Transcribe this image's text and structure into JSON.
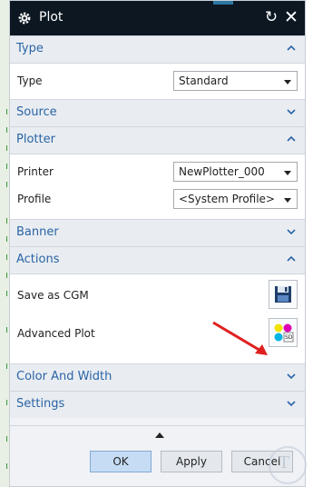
{
  "window": {
    "title": "Plot"
  },
  "sections": {
    "type": {
      "title": "Type",
      "expanded": true,
      "rows": [
        {
          "label": "Type",
          "value": "Standard"
        }
      ]
    },
    "source": {
      "title": "Source",
      "expanded": false
    },
    "plotter": {
      "title": "Plotter",
      "expanded": true,
      "rows": [
        {
          "label": "Printer",
          "value": "NewPlotter_000"
        },
        {
          "label": "Profile",
          "value": "<System Profile>"
        }
      ]
    },
    "banner": {
      "title": "Banner",
      "expanded": false
    },
    "actions": {
      "title": "Actions",
      "expanded": true,
      "rows": [
        {
          "label": "Save as CGM",
          "icon": "save-icon"
        },
        {
          "label": "Advanced Plot",
          "icon": "advanced-plot-icon"
        }
      ]
    },
    "color_width": {
      "title": "Color And Width",
      "expanded": false
    },
    "settings": {
      "title": "Settings",
      "expanded": false
    }
  },
  "footer": {
    "ok_label": "OK",
    "apply_label": "Apply",
    "cancel_label": "Cancel"
  },
  "colors": {
    "titlebar": "#0c1722",
    "section_label": "#2b64a5",
    "ok_button": "#c5dcf4",
    "annotation_arrow": "#e02020"
  }
}
